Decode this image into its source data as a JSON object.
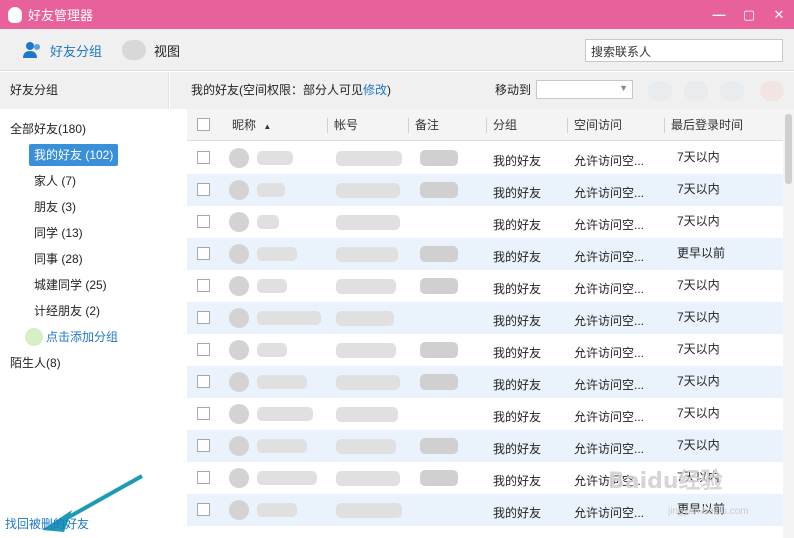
{
  "window": {
    "title": "好友管理器",
    "btn_min": "—",
    "btn_max": "▢",
    "btn_close": "✕"
  },
  "toolbar": {
    "tab_groups": "好友分组",
    "tab_view": "视图",
    "search_placeholder": "搜索联系人"
  },
  "sidebar": {
    "header": "好友分组",
    "groups": [
      {
        "label": "全部好友(180)"
      },
      {
        "label": "我的好友 (102)"
      },
      {
        "label": "家人 (7)"
      },
      {
        "label": "朋友 (3)"
      },
      {
        "label": "同学 (13)"
      },
      {
        "label": "同事 (28)"
      },
      {
        "label": "城建同学 (25)"
      },
      {
        "label": "计经朋友 (2)"
      }
    ],
    "add_group": "点击添加分组",
    "strangers": "陌生人(8)",
    "recover": "找回被删的好友"
  },
  "info": {
    "prefix": "我的好友(空间权限：部分人可见",
    "link": "修改",
    "suffix": ")",
    "move_to": "移动到"
  },
  "table": {
    "headers": {
      "nickname": "昵称",
      "account": "帐号",
      "remark": "备注",
      "group": "分组",
      "space": "空间访问",
      "last_login": "最后登录时间"
    },
    "sort_arrow": "▲",
    "rows": [
      {
        "group": "我的好友",
        "space": "允许访问空...",
        "last_login": "7天以内"
      },
      {
        "group": "我的好友",
        "space": "允许访问空...",
        "last_login": "7天以内"
      },
      {
        "group": "我的好友",
        "space": "允许访问空...",
        "last_login": "7天以内"
      },
      {
        "group": "我的好友",
        "space": "允许访问空...",
        "last_login": "更早以前"
      },
      {
        "group": "我的好友",
        "space": "允许访问空...",
        "last_login": "7天以内"
      },
      {
        "group": "我的好友",
        "space": "允许访问空...",
        "last_login": "7天以内"
      },
      {
        "group": "我的好友",
        "space": "允许访问空...",
        "last_login": "7天以内"
      },
      {
        "group": "我的好友",
        "space": "允许访问空...",
        "last_login": "7天以内"
      },
      {
        "group": "我的好友",
        "space": "允许访问空...",
        "last_login": "7天以内"
      },
      {
        "group": "我的好友",
        "space": "允许访问空...",
        "last_login": "7天以内"
      },
      {
        "group": "我的好友",
        "space": "允许访问空...",
        "last_login": "7天以内"
      },
      {
        "group": "我的好友",
        "space": "允许访问空...",
        "last_login": "更早以前"
      }
    ]
  },
  "watermark": {
    "brand": "Baidu经验",
    "url": "jingyan.baidu.com"
  },
  "colors": {
    "title_bar": "#e8619b",
    "accent": "#1e78c8",
    "selected": "#3a8fd9",
    "row_alt": "#eaf3fb"
  }
}
